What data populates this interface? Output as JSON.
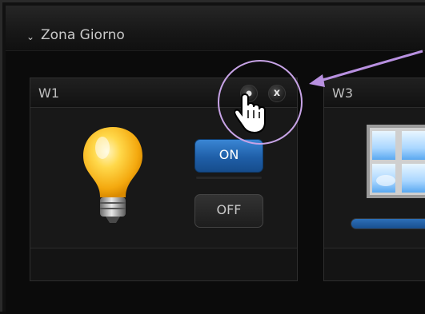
{
  "zone": {
    "chevron_icon": "chevron-down-icon",
    "title": "Zona Giorno"
  },
  "widgets": [
    {
      "title": "W1",
      "buttons": {
        "settings_icon": "wrench-icon",
        "close_label": "x"
      },
      "device_icon": "lightbulb-icon",
      "on_label": "ON",
      "off_label": "OFF",
      "state": "ON"
    },
    {
      "title": "W3",
      "device_icon": "window-icon",
      "shade_level_percent": 100
    }
  ],
  "annotation": {
    "circle_color": "#c7a3e6",
    "arrow_color": "#b890e0",
    "cursor_icon": "hand-pointer-icon"
  },
  "colors": {
    "accent_blue": "#2a74c4",
    "background": "#0c0c0c"
  }
}
